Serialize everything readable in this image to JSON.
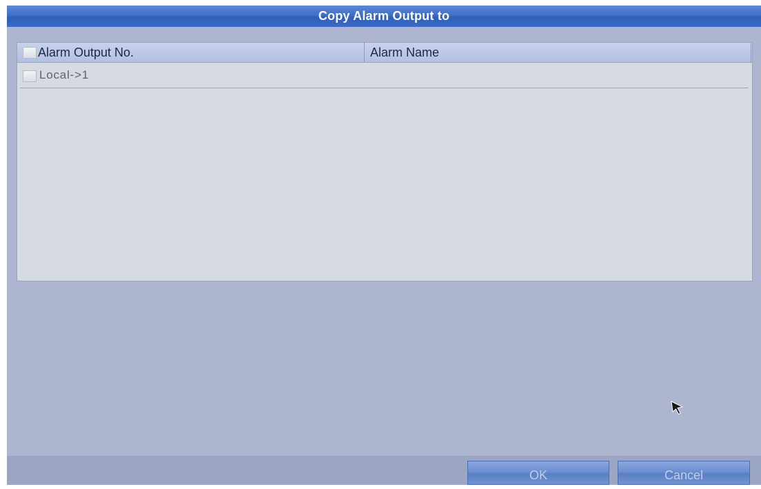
{
  "dialog": {
    "title": "Copy Alarm Output to"
  },
  "table": {
    "columns": [
      "Alarm Output No.",
      "Alarm Name"
    ],
    "select_all_checked": false,
    "rows": [
      {
        "output_no": "Local->1",
        "alarm_name": "",
        "checked": false
      }
    ]
  },
  "buttons": {
    "ok_label": "OK",
    "cancel_label": "Cancel"
  },
  "icons": {
    "cursor": "mouse-pointer-icon"
  },
  "colors": {
    "title_bar": "#3f6fc8",
    "dialog_bg": "#aeb5d0",
    "table_bg": "#d5dbe0",
    "button": "#6c8fd1"
  }
}
